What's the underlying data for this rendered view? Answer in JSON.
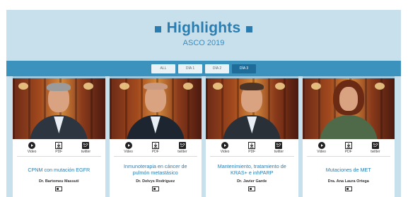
{
  "header": {
    "title": "Highlights",
    "subtitle": "ASCO 2019"
  },
  "tabs": [
    {
      "label": "ALL",
      "active": false
    },
    {
      "label": "DÍA 1",
      "active": false
    },
    {
      "label": "DÍA 2",
      "active": false
    },
    {
      "label": "DÍA 3",
      "active": true
    }
  ],
  "media_labels": {
    "video": "Video",
    "pdf": "PDF",
    "twitter": "twitter"
  },
  "cards": [
    {
      "title": "CPNM con mutación EGFR",
      "speaker": "Dr. Bartomeu Massutí"
    },
    {
      "title": "Inmunoterapia en cáncer de pulmón metastásico",
      "speaker": "Dr. Delvys Rodríguez"
    },
    {
      "title": "Mantenimiento, tratamiento de KRAS+ e inhPARP",
      "speaker": "Dr. Javier Garde"
    },
    {
      "title": "Mutaciones de MET",
      "speaker": "Dra. Ana Laura Ortega"
    }
  ],
  "colors": {
    "accent": "#2a7db1",
    "panel_bg": "#c8e0ec",
    "tabbar_bg": "#3a92bd",
    "tab_active": "#1f6c98"
  }
}
